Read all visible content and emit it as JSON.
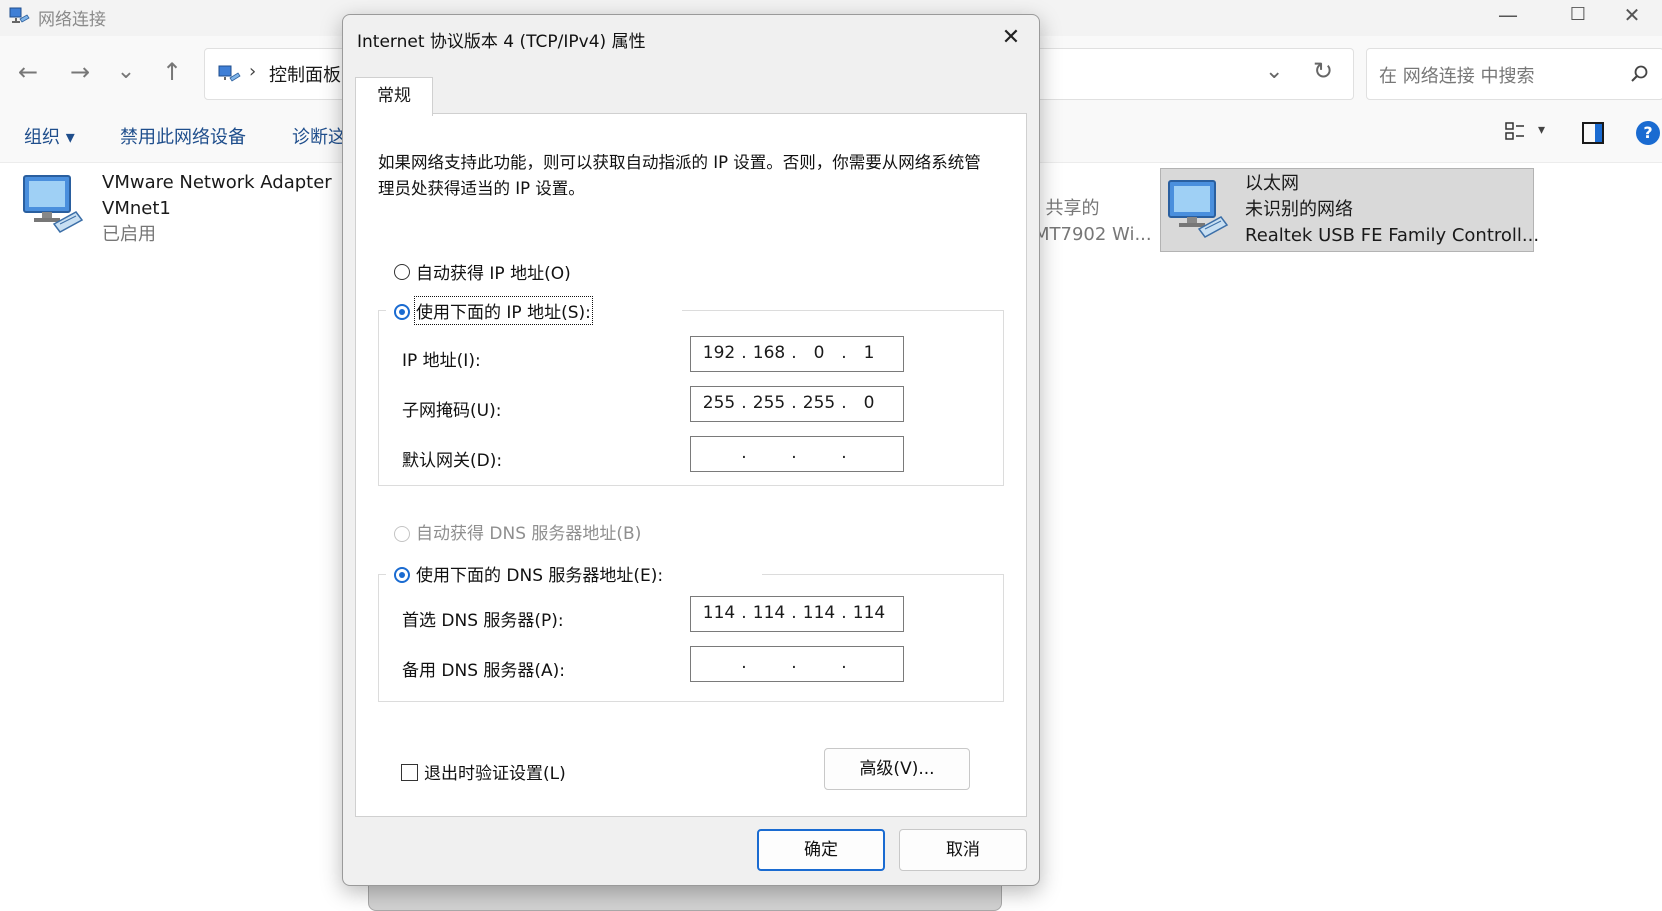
{
  "window": {
    "title": "网络连接",
    "minimize": "—",
    "maximize": "☐",
    "close": "✕"
  },
  "nav": {
    "back": "←",
    "forward": "→",
    "recent": "⌄",
    "up": "↑",
    "breadcrumb_sep": "›",
    "breadcrumb": "控制面板",
    "address_dropdown": "⌄",
    "refresh": "↻",
    "search_placeholder": "在 网络连接 中搜索"
  },
  "command_bar": {
    "organize": "组织 ▾",
    "disable": "禁用此网络设备",
    "diagnose": "诊断这"
  },
  "adapters": {
    "vmware": {
      "line1": "VMware Network Adapter",
      "line2": "VMnet1",
      "status": "已启用"
    },
    "wifi_partial": {
      "line1": ", 共享的",
      "line2": "MT7902 Wi..."
    },
    "ethernet": {
      "name": "以太网",
      "status": "未识别的网络",
      "device": "Realtek USB FE Family Controll..."
    }
  },
  "dialog": {
    "title": "Internet 协议版本 4 (TCP/IPv4) 属性",
    "close": "✕",
    "tab": "常规",
    "intro": "如果网络支持此功能，则可以获取自动指派的 IP 设置。否则，你需要从网络系统管理员处获得适当的 IP 设置。",
    "auto_ip": "自动获得 IP 地址(O)",
    "manual_ip": "使用下面的 IP 地址(S):",
    "ip_label": "IP 地址(I):",
    "ip_value": [
      "192",
      "168",
      "0",
      "1"
    ],
    "mask_label": "子网掩码(U):",
    "mask_value": [
      "255",
      "255",
      "255",
      "0"
    ],
    "gateway_label": "默认网关(D):",
    "gateway_value": [
      "",
      "",
      "",
      ""
    ],
    "auto_dns": "自动获得 DNS 服务器地址(B)",
    "manual_dns": "使用下面的 DNS 服务器地址(E):",
    "dns1_label": "首选 DNS 服务器(P):",
    "dns1_value": [
      "114",
      "114",
      "114",
      "114"
    ],
    "dns2_label": "备用 DNS 服务器(A):",
    "dns2_value": [
      "",
      "",
      "",
      ""
    ],
    "validate": "退出时验证设置(L)",
    "advanced": "高级(V)...",
    "ok": "确定",
    "cancel": "取消"
  }
}
